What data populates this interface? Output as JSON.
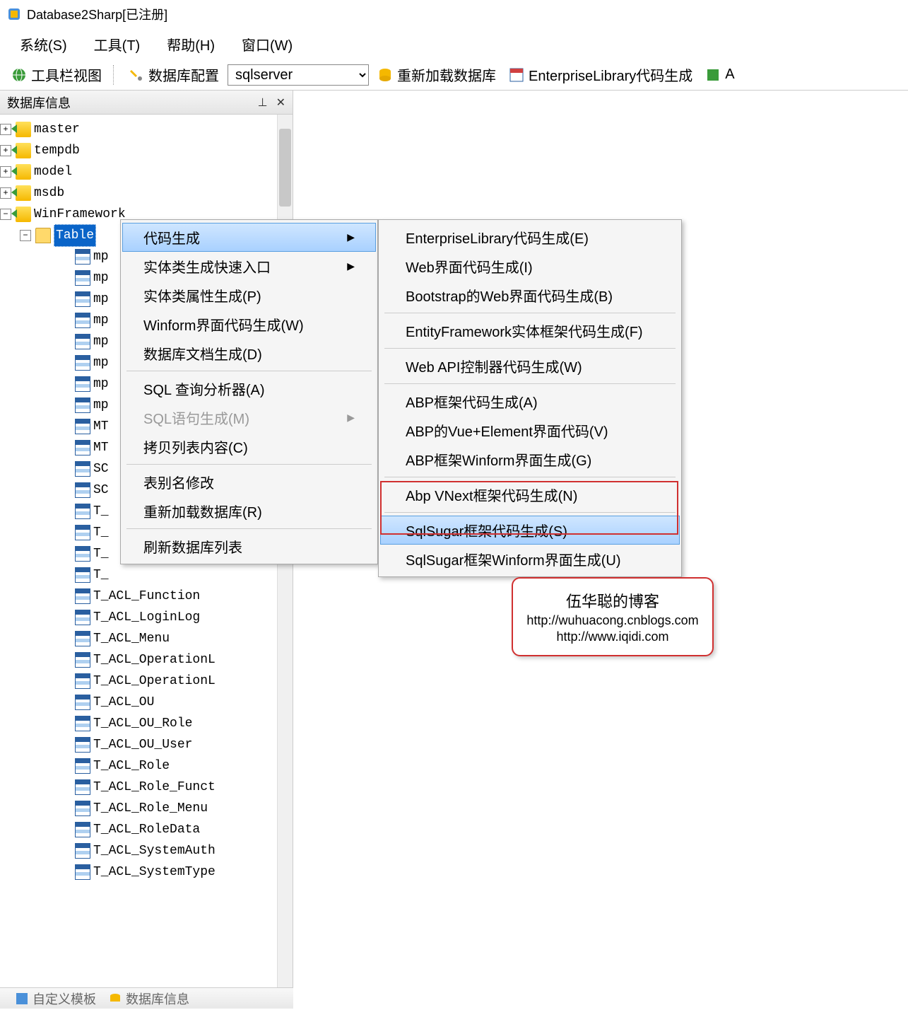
{
  "window": {
    "title": "Database2Sharp[已注册]"
  },
  "menubar": {
    "items": [
      "系统(S)",
      "工具(T)",
      "帮助(H)",
      "窗口(W)"
    ]
  },
  "toolbar": {
    "toolview": "工具栏视图",
    "dbconfig": "数据库配置",
    "db_select": "sqlserver",
    "reload": "重新加载数据库",
    "entlib": "EnterpriseLibrary代码生成",
    "extra": "A"
  },
  "sidepanel": {
    "title": "数据库信息",
    "pin": "⊥",
    "close": "✕",
    "databases": [
      {
        "name": "master",
        "expanded": false
      },
      {
        "name": "tempdb",
        "expanded": false
      },
      {
        "name": "model",
        "expanded": false
      },
      {
        "name": "msdb",
        "expanded": false
      },
      {
        "name": "WinFramework",
        "expanded": true
      }
    ],
    "tables_node": "Table",
    "tables": [
      "mp",
      "mp",
      "mp",
      "mp",
      "mp",
      "mp",
      "mp",
      "mp",
      "MT",
      "MT",
      "SC",
      "SC",
      "T_",
      "T_",
      "T_",
      "T_",
      "T_ACL_Function",
      "T_ACL_LoginLog",
      "T_ACL_Menu",
      "T_ACL_OperationL",
      "T_ACL_OperationL",
      "T_ACL_OU",
      "T_ACL_OU_Role",
      "T_ACL_OU_User",
      "T_ACL_Role",
      "T_ACL_Role_Funct",
      "T_ACL_Role_Menu",
      "T_ACL_RoleData",
      "T_ACL_SystemAuth",
      "T_ACL_SystemType"
    ]
  },
  "context_menu_1": {
    "items": [
      {
        "label": "代码生成",
        "submenu": true,
        "highlight": true
      },
      {
        "label": "实体类生成快速入口",
        "submenu": true
      },
      {
        "label": "实体类属性生成(P)"
      },
      {
        "label": "Winform界面代码生成(W)"
      },
      {
        "label": "数据库文档生成(D)"
      },
      {
        "sep": true
      },
      {
        "label": "SQL 查询分析器(A)"
      },
      {
        "label": "SQL语句生成(M)",
        "submenu": true,
        "disabled": true
      },
      {
        "label": "拷贝列表内容(C)"
      },
      {
        "sep": true
      },
      {
        "label": "表别名修改"
      },
      {
        "label": "重新加载数据库(R)"
      },
      {
        "sep": true
      },
      {
        "label": "刷新数据库列表"
      }
    ]
  },
  "context_menu_2": {
    "items": [
      {
        "label": "EnterpriseLibrary代码生成(E)"
      },
      {
        "label": "Web界面代码生成(I)"
      },
      {
        "label": "Bootstrap的Web界面代码生成(B)"
      },
      {
        "sep": true
      },
      {
        "label": "EntityFramework实体框架代码生成(F)"
      },
      {
        "sep": true
      },
      {
        "label": "Web API控制器代码生成(W)"
      },
      {
        "sep": true
      },
      {
        "label": "ABP框架代码生成(A)"
      },
      {
        "label": "ABP的Vue+Element界面代码(V)"
      },
      {
        "label": "ABP框架Winform界面生成(G)"
      },
      {
        "sep": true
      },
      {
        "label": "Abp VNext框架代码生成(N)"
      },
      {
        "sep": true
      },
      {
        "label": "SqlSugar框架代码生成(S)",
        "highlight": true
      },
      {
        "label": "SqlSugar框架Winform界面生成(U)"
      }
    ]
  },
  "watermark": {
    "title": "伍华聪的博客",
    "url1": "http://wuhuacong.cnblogs.com",
    "url2": "http://www.iqidi.com"
  },
  "bottom_tabs": {
    "tab1": "自定义模板",
    "tab2": "数据库信息"
  }
}
